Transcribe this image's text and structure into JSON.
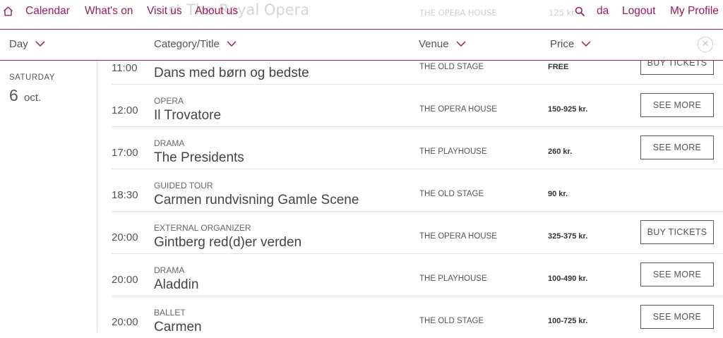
{
  "nav": {
    "calendar": "Calendar",
    "whats_on": "What's on",
    "visit_us": "Visit us",
    "about_us": "About us",
    "language": "da",
    "logout": "Logout",
    "my_profile": "My Profile",
    "home_icon": "home-icon",
    "search_icon": "search-icon"
  },
  "behind_header": {
    "title": "st The Royal Opera",
    "venue": "THE OPERA HOUSE",
    "price": "125 kr."
  },
  "filters": {
    "day": "Day",
    "category_title": "Category/Title",
    "venue": "Venue",
    "price": "Price",
    "close_icon": "close-icon"
  },
  "date": {
    "weekday": "SATURDAY",
    "day": "6",
    "month": "oct."
  },
  "events": [
    {
      "time": "11:00",
      "category": "",
      "title": "Dans med børn og bedste",
      "venue": "THE OLD STAGE",
      "price": "FREE",
      "button": "BUY TICKETS"
    },
    {
      "time": "12:00",
      "category": "OPERA",
      "title": "Il Trovatore",
      "venue": "THE OPERA HOUSE",
      "price": "150-925 kr.",
      "button": "SEE MORE"
    },
    {
      "time": "17:00",
      "category": "DRAMA",
      "title": "The Presidents",
      "venue": "THE PLAYHOUSE",
      "price": "260 kr.",
      "button": "SEE MORE"
    },
    {
      "time": "18:30",
      "category": "GUIDED TOUR",
      "title": "Carmen rundvisning Gamle Scene",
      "venue": "THE OLD STAGE",
      "price": "90 kr.",
      "button": ""
    },
    {
      "time": "20:00",
      "category": "EXTERNAL ORGANIZER",
      "title": "Gintberg red(d)er verden",
      "venue": "THE OPERA HOUSE",
      "price": "325-375 kr.",
      "button": "BUY TICKETS"
    },
    {
      "time": "20:00",
      "category": "DRAMA",
      "title": "Aladdin",
      "venue": "THE PLAYHOUSE",
      "price": "100-490 kr.",
      "button": "SEE MORE"
    },
    {
      "time": "20:00",
      "category": "BALLET",
      "title": "Carmen",
      "venue": "THE OLD STAGE",
      "price": "100-725 kr.",
      "button": "SEE MORE"
    }
  ],
  "colors": {
    "accent": "#a0195a",
    "text": "#444444",
    "divider": "#e3e3e3"
  }
}
